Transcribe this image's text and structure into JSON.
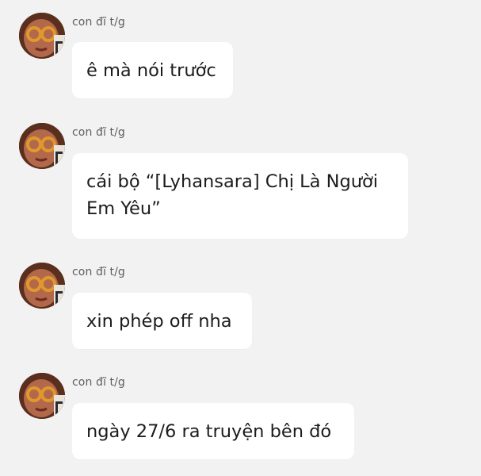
{
  "messages": [
    {
      "sender": "con đĩ t/g",
      "text": "ê mà nói trước",
      "avatar_icon": "user-avatar-icon"
    },
    {
      "sender": "con đĩ t/g",
      "text": "cái bộ “[Lyhansara] Chị Là Người Em Yêu”",
      "avatar_icon": "user-avatar-icon"
    },
    {
      "sender": "con đĩ t/g",
      "text": "xin phép off nha",
      "avatar_icon": "user-avatar-icon"
    },
    {
      "sender": "con đĩ t/g",
      "text": "ngày 27/6 ra truyện bên đó",
      "avatar_icon": "user-avatar-icon"
    }
  ],
  "colors": {
    "background": "#f2f2f2",
    "bubble": "#ffffff",
    "text": "#1c1c1c",
    "sender": "#5f5f5f"
  }
}
